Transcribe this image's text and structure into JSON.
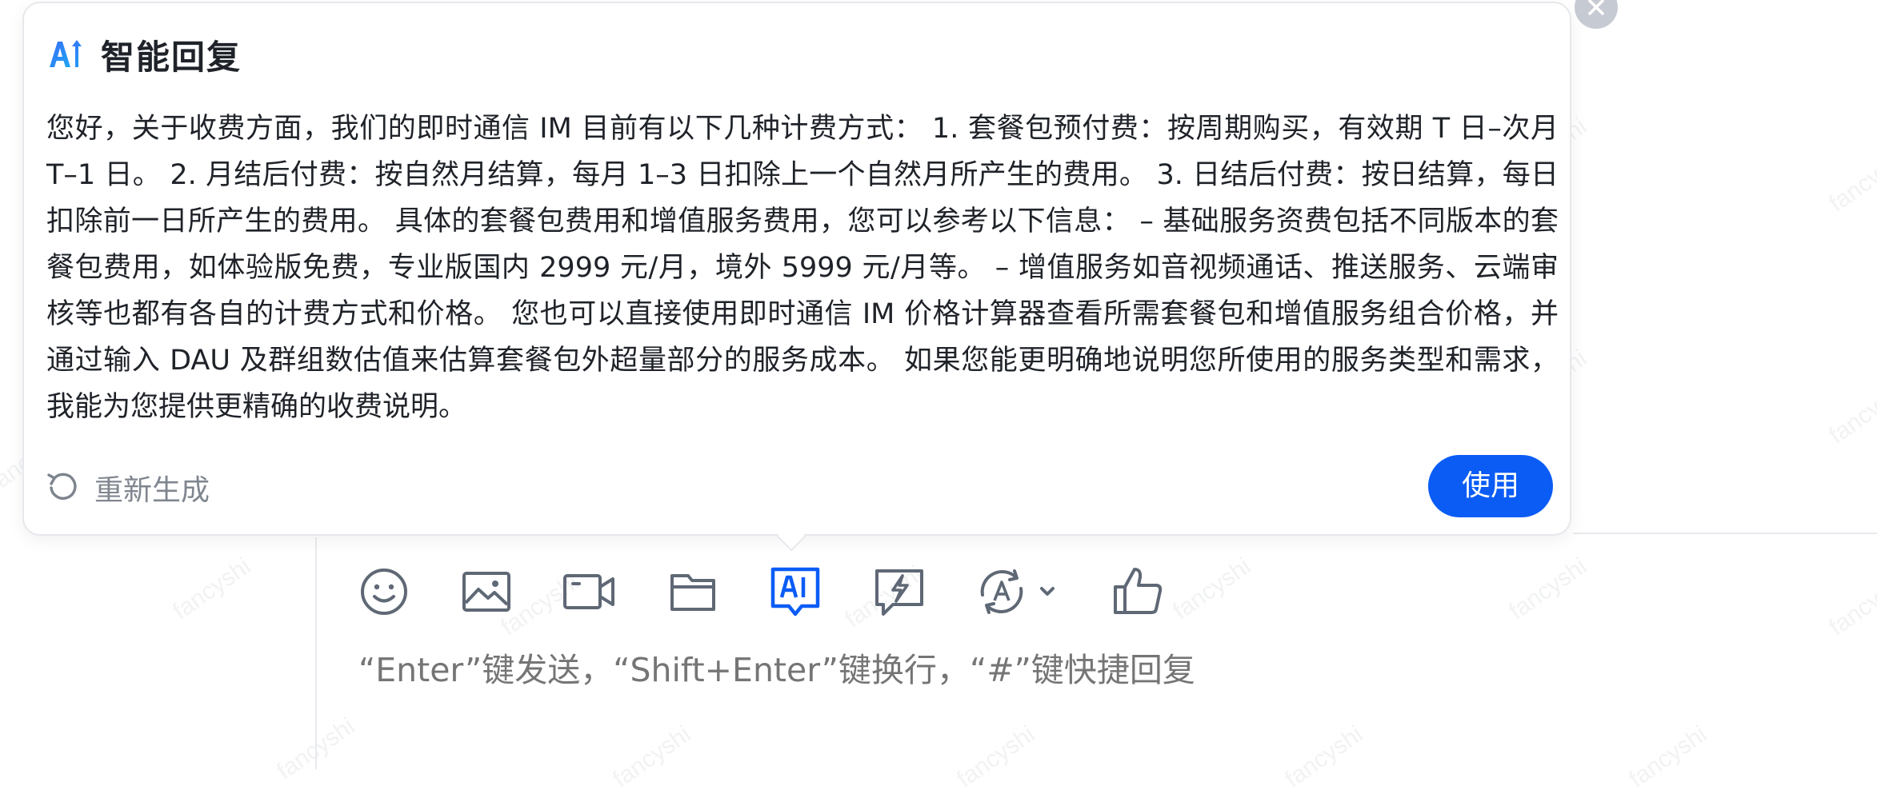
{
  "watermark": "fancyshi",
  "smart_reply": {
    "title": "智能回复",
    "logo_icon": "ai-spark-logo",
    "content": "您好，关于收费方面，我们的即时通信 IM 目前有以下几种计费方式： 1. 套餐包预付费：按周期购买，有效期 T 日–次月 T–1 日。 2. 月结后付费：按自然月结算，每月 1–3 日扣除上一个自然月所产生的费用。 3. 日结后付费：按日结算，每日扣除前一日所产生的费用。 具体的套餐包费用和增值服务费用，您可以参考以下信息： – 基础服务资费包括不同版本的套餐包费用，如体验版免费，专业版国内 2999 元/月，境外 5999 元/月等。 – 增值服务如音视频通话、推送服务、云端审核等也都有各自的计费方式和价格。 您也可以直接使用即时通信 IM 价格计算器查看所需套餐包和增值服务组合价格，并通过输入 DAU 及群组数估值来估算套餐包外超量部分的服务成本。 如果您能更明确地说明您所使用的服务类型和需求，我能为您提供更精确的收费说明。",
    "regenerate_label": "重新生成",
    "use_label": "使用"
  },
  "toolbar": {
    "items": [
      "emoji-icon",
      "image-icon",
      "video-icon",
      "folder-icon",
      "ai-reply-icon",
      "quick-reply-icon",
      "translate-icon",
      "thumbs-up-icon"
    ],
    "active": "ai-reply-icon"
  },
  "input": {
    "placeholder": "“Enter”键发送，“Shift+Enter”键换行，“#”键快捷回复"
  },
  "colors": {
    "accent": "#0a5cf5",
    "icon": "#5f6875",
    "muted_text": "#80868f",
    "placeholder": "#a4a9b1"
  }
}
